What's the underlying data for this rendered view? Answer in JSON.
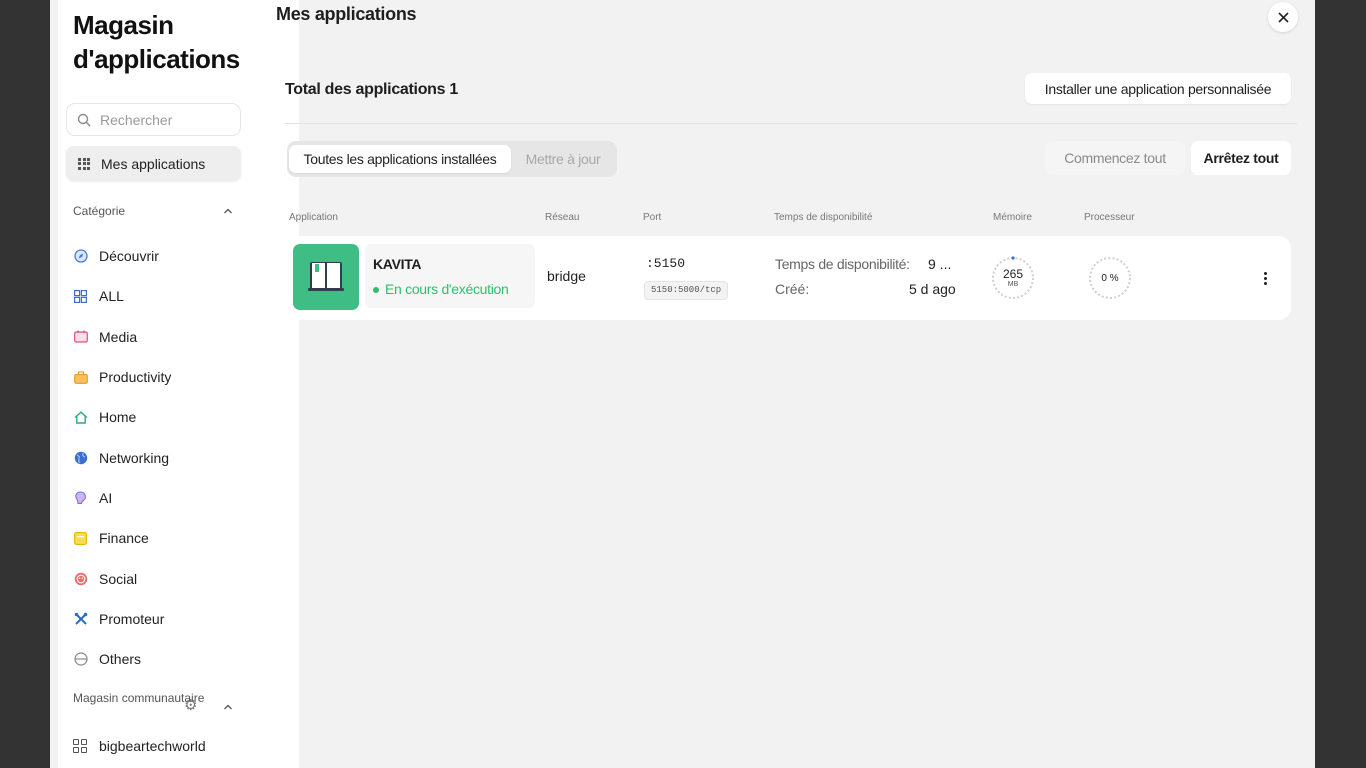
{
  "sidebar": {
    "title": "Magasin d'applications",
    "search_placeholder": "Rechercher",
    "my_apps_label": "Mes applications",
    "category_heading": "Catégorie",
    "categories": [
      {
        "label": "Découvrir",
        "icon": "compass-icon",
        "color": "#4a7bd8"
      },
      {
        "label": "ALL",
        "icon": "grid-icon",
        "color": "#3a6fd0"
      },
      {
        "label": "Media",
        "icon": "media-icon",
        "color": "#e0507a"
      },
      {
        "label": "Productivity",
        "icon": "briefcase-icon",
        "color": "#f0a030"
      },
      {
        "label": "Home",
        "icon": "house-icon",
        "color": "#2fa97a"
      },
      {
        "label": "Networking",
        "icon": "globe-icon",
        "color": "#3a6fd0"
      },
      {
        "label": "AI",
        "icon": "brain-icon",
        "color": "#8a6ad8"
      },
      {
        "label": "Finance",
        "icon": "wallet-icon",
        "color": "#e8c020"
      },
      {
        "label": "Social",
        "icon": "smiley-icon",
        "color": "#e05050"
      },
      {
        "label": "Promoteur",
        "icon": "tools-icon",
        "color": "#2a6fc0"
      },
      {
        "label": "Others",
        "icon": "others-icon",
        "color": "#888888"
      }
    ],
    "community_heading": "Magasin communautaire",
    "community_items": [
      {
        "label": "bigbeartechworld",
        "icon": "apps-icon"
      }
    ]
  },
  "header": {
    "title": "Mes applications"
  },
  "main": {
    "total_label": "Total des applications 1",
    "install_custom_label": "Installer une application personnalisée",
    "tabs": [
      {
        "label": "Toutes les applications installées",
        "active": true
      },
      {
        "label": "Mettre à jour",
        "active": false
      }
    ],
    "start_all_label": "Commencez tout",
    "stop_all_label": "Arrêtez tout",
    "columns": [
      "Application",
      "Réseau",
      "Port",
      "Temps de disponibilité",
      "Mémoire",
      "Processeur"
    ],
    "apps": [
      {
        "name": "KAVITA",
        "status": "En cours d'exécution",
        "status_color": "#2fbf6a",
        "icon_color": "#3ebd85",
        "network": "bridge",
        "port": ":5150",
        "port_mapping": "5150:5000/tcp",
        "uptime_label": "Temps de disponibilité:",
        "uptime_value": "9 ...",
        "created_label": "Créé:",
        "created_value": "5 d ago",
        "memory_value": "265",
        "memory_unit": "MB",
        "cpu_value": "0 %"
      }
    ]
  }
}
